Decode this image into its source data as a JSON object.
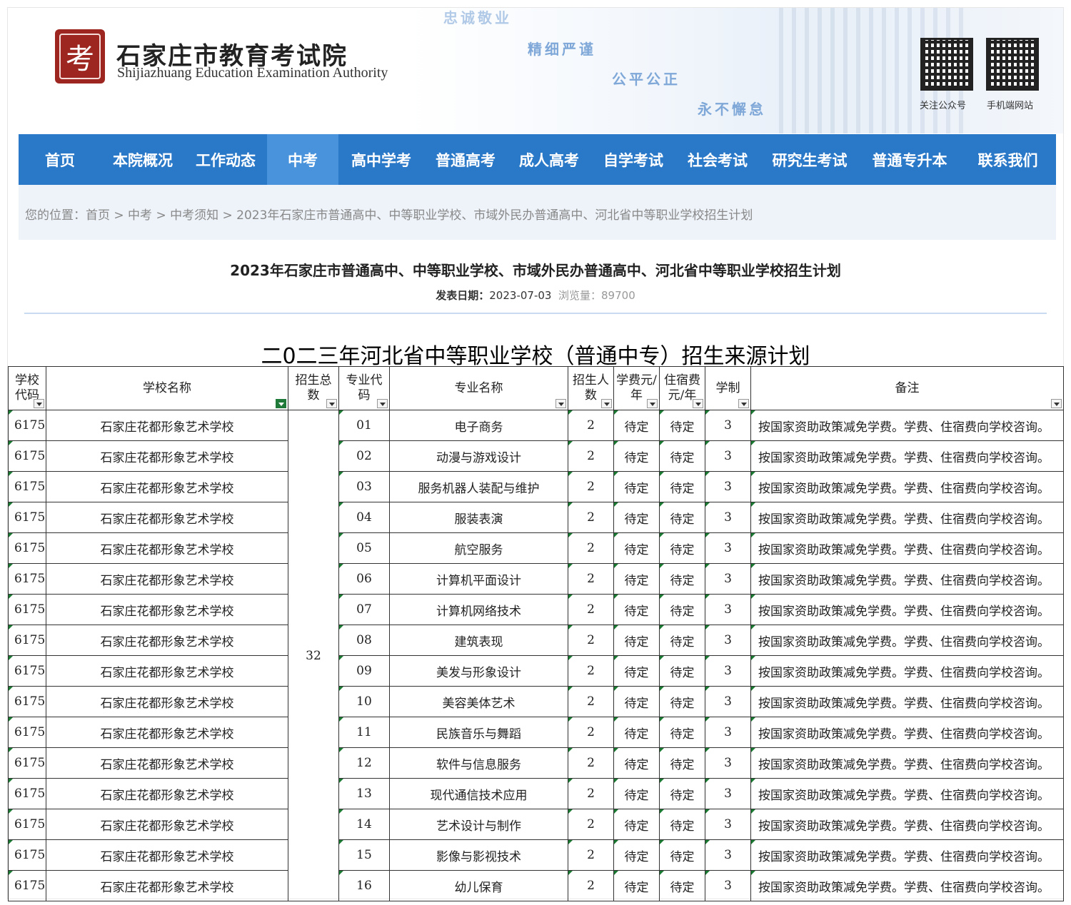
{
  "header": {
    "seal_char": "考",
    "org_name_cn": "石家庄市教育考试院",
    "org_name_en": "Shijiazhuang Education Examination Authority",
    "mottos": [
      "忠诚敬业",
      "精细严谨",
      "公平公正",
      "永不懈怠"
    ],
    "qr_labels": [
      "关注公众号",
      "手机端网站"
    ]
  },
  "nav": [
    "首页",
    "本院概况",
    "工作动态",
    "中考",
    "高中学考",
    "普通高考",
    "成人高考",
    "自学考试",
    "社会考试",
    "研究生考试",
    "普通专升本",
    "联系我们"
  ],
  "nav_active": "中考",
  "breadcrumb": "您的位置：首页 > 中考 > 中考须知 > 2023年石家庄市普通高中、中等职业学校、市域外民办普通高中、河北省中等职业学校招生计划",
  "article": {
    "title": "2023年石家庄市普通高中、中等职业学校、市域外民办普通高中、河北省中等职业学校招生计划",
    "date_label": "发表日期：",
    "date": "2023-07-03",
    "views_label": "浏览量：",
    "views": "89700"
  },
  "sheet": {
    "title": "二0二三年河北省中等职业学校（普通中专）招生来源计划",
    "headers": [
      "学校代码",
      "学校名称",
      "招生总数",
      "专业代码",
      "专业名称",
      "招生人数",
      "学费元/年",
      "住宿费元/年",
      "学制",
      "备注"
    ],
    "school_code": "6175",
    "school_name": "石家庄花都形象艺术学校",
    "total": "32",
    "fee": "待定",
    "dorm_fee": "待定",
    "duration": "3",
    "quota": "2",
    "note": "按国家资助政策减免学费。学费、住宿费向学校咨询。",
    "majors": [
      {
        "code": "01",
        "name": "电子商务"
      },
      {
        "code": "02",
        "name": "动漫与游戏设计"
      },
      {
        "code": "03",
        "name": "服务机器人装配与维护"
      },
      {
        "code": "04",
        "name": "服装表演"
      },
      {
        "code": "05",
        "name": "航空服务"
      },
      {
        "code": "06",
        "name": "计算机平面设计"
      },
      {
        "code": "07",
        "name": "计算机网络技术"
      },
      {
        "code": "08",
        "name": "建筑表现"
      },
      {
        "code": "09",
        "name": "美发与形象设计"
      },
      {
        "code": "10",
        "name": "美容美体艺术"
      },
      {
        "code": "11",
        "name": "民族音乐与舞蹈"
      },
      {
        "code": "12",
        "name": "软件与信息服务"
      },
      {
        "code": "13",
        "name": "现代通信技术应用"
      },
      {
        "code": "14",
        "name": "艺术设计与制作"
      },
      {
        "code": "15",
        "name": "影像与影视技术"
      },
      {
        "code": "16",
        "name": "幼儿保育"
      }
    ]
  }
}
